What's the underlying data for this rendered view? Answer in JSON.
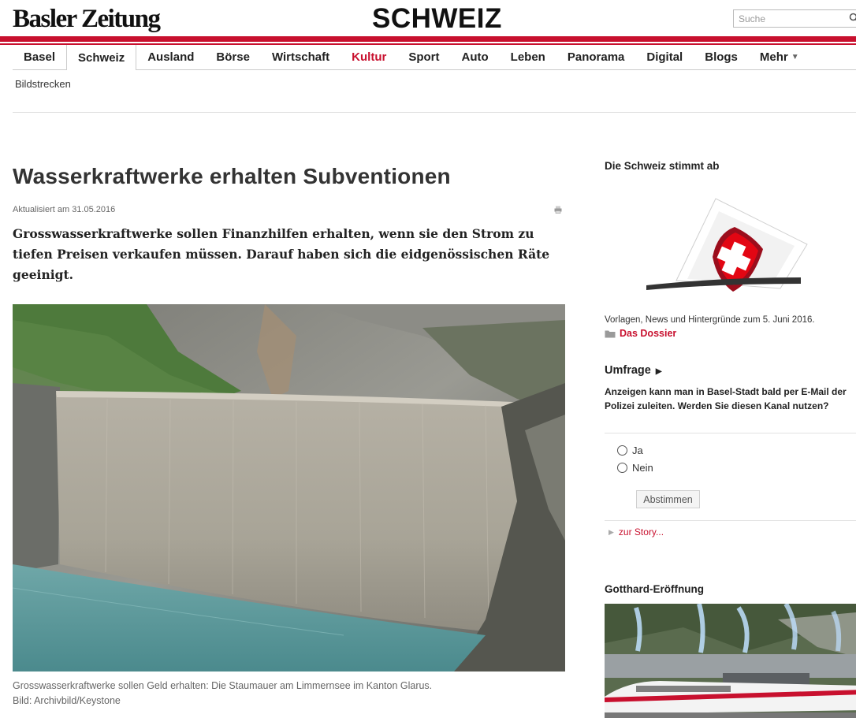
{
  "header": {
    "logo": "Basler Zeitung",
    "section_title": "SCHWEIZ",
    "search_placeholder": "Suche"
  },
  "nav": {
    "items": [
      {
        "label": "Basel"
      },
      {
        "label": "Schweiz"
      },
      {
        "label": "Ausland"
      },
      {
        "label": "Börse"
      },
      {
        "label": "Wirtschaft"
      },
      {
        "label": "Kultur"
      },
      {
        "label": "Sport"
      },
      {
        "label": "Auto"
      },
      {
        "label": "Leben"
      },
      {
        "label": "Panorama"
      },
      {
        "label": "Digital"
      },
      {
        "label": "Blogs"
      },
      {
        "label": "Mehr"
      }
    ],
    "active_item": "Schweiz",
    "highlight_item": "Kultur"
  },
  "subnav": {
    "label": "Bildstrecken"
  },
  "article": {
    "headline": "Wasserkraftwerke erhalten Subventionen",
    "updated": "Aktualisiert am 31.05.2016",
    "lead": "Grosswasserkraftwerke sollen Finanzhilfen erhalten, wenn sie den Strom zu tiefen Preisen verkaufen müssen. Darauf haben sich die eidgenössischen Räte geeinigt.",
    "caption_line1": "Grosswasserkraftwerke sollen Geld erhalten: Die Staumauer am Limmernsee im Kanton Glarus.",
    "caption_line2": "Bild: Archivbild/Keystone"
  },
  "sidebar": {
    "vote_heading": "Die Schweiz stimmt ab",
    "vote_text": "Vorlagen, News und Hintergründe zum 5. Juni 2016.",
    "dossier_link": "Das Dossier",
    "poll_heading": "Umfrage",
    "poll_question": "Anzeigen kann man in Basel-Stadt bald per E-Mail der Polizei zuleiten. Werden Sie diesen Kanal nutzen?",
    "poll_options": [
      {
        "label": "Ja"
      },
      {
        "label": "Nein"
      }
    ],
    "vote_button": "Abstimmen",
    "story_link": "zur Story...",
    "gotthard_heading": "Gotthard-Eröffnung"
  },
  "colors": {
    "brand_red": "#c8102e",
    "text": "#222222",
    "muted": "#666666"
  },
  "icons": [
    "search-icon",
    "print-icon",
    "folder-icon",
    "chevron-right-icon",
    "chevron-down-icon"
  ]
}
